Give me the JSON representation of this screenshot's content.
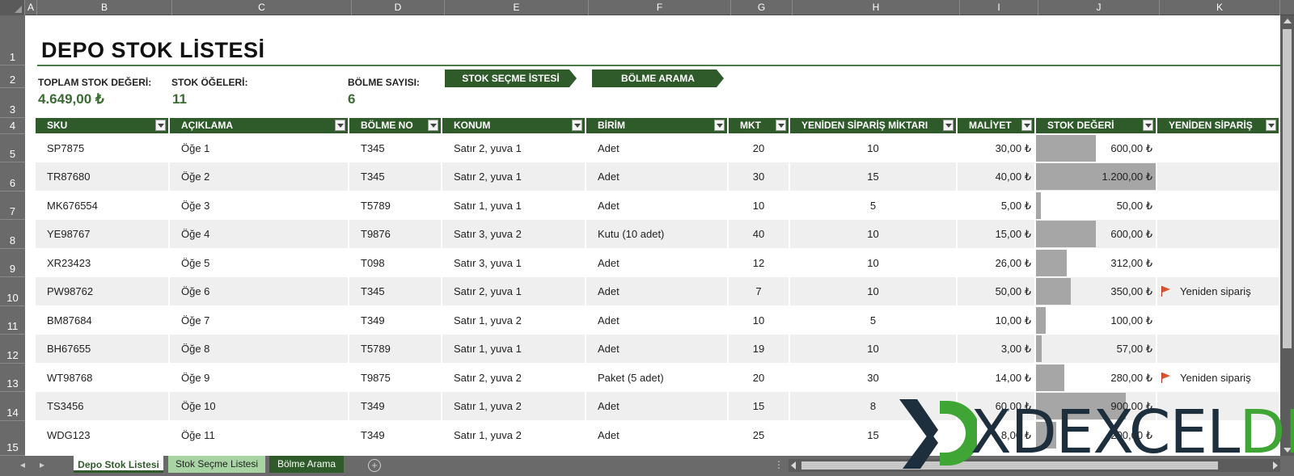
{
  "column_headers": [
    "A",
    "B",
    "C",
    "D",
    "E",
    "F",
    "G",
    "H",
    "I",
    "J",
    "K"
  ],
  "row_headers": [
    "1",
    "2",
    "3",
    "4",
    "5",
    "6",
    "7",
    "8",
    "9",
    "10",
    "11",
    "12",
    "13",
    "14",
    "15"
  ],
  "title": "DEPO STOK LİSTESİ",
  "kpis": [
    {
      "label": "TOPLAM STOK DEĞERİ:",
      "value": "4.649,00 ₺"
    },
    {
      "label": "STOK ÖĞELERİ:",
      "value": "11"
    },
    {
      "label": "BÖLME SAYISI:",
      "value": "6"
    }
  ],
  "nav_buttons": [
    "STOK SEÇME İSTESİ",
    "BÖLME ARAMA"
  ],
  "table": {
    "headers": [
      "SKU",
      "AÇIKLAMA",
      "BÖLME NO",
      "KONUM",
      "BİRİM",
      "MKT",
      "YENİDEN SİPARİŞ MİKTARI",
      "MALİYET",
      "STOK DEĞERİ",
      "YENİDEN SİPARİŞ"
    ],
    "stock_value_max": 1200,
    "rows": [
      {
        "sku": "SP7875",
        "desc": "Öğe 1",
        "bin": "T345",
        "loc": "Satır 2, yuva 1",
        "unit": "Adet",
        "qty": "20",
        "reorder_qty": "10",
        "cost": "30,00 ₺",
        "value": "600,00 ₺",
        "value_num": 600,
        "reorder": ""
      },
      {
        "sku": "TR87680",
        "desc": "Öğe 2",
        "bin": "T345",
        "loc": "Satır 2, yuva 1",
        "unit": "Adet",
        "qty": "30",
        "reorder_qty": "15",
        "cost": "40,00 ₺",
        "value": "1.200,00 ₺",
        "value_num": 1200,
        "reorder": ""
      },
      {
        "sku": "MK676554",
        "desc": "Öğe 3",
        "bin": "T5789",
        "loc": "Satır 1, yuva 1",
        "unit": "Adet",
        "qty": "10",
        "reorder_qty": "5",
        "cost": "5,00 ₺",
        "value": "50,00 ₺",
        "value_num": 50,
        "reorder": ""
      },
      {
        "sku": "YE98767",
        "desc": "Öğe 4",
        "bin": "T9876",
        "loc": "Satır 3, yuva 2",
        "unit": "Kutu (10 adet)",
        "qty": "40",
        "reorder_qty": "10",
        "cost": "15,00 ₺",
        "value": "600,00 ₺",
        "value_num": 600,
        "reorder": ""
      },
      {
        "sku": "XR23423",
        "desc": "Öğe 5",
        "bin": "T098",
        "loc": "Satır 3, yuva 1",
        "unit": "Adet",
        "qty": "12",
        "reorder_qty": "10",
        "cost": "26,00 ₺",
        "value": "312,00 ₺",
        "value_num": 312,
        "reorder": ""
      },
      {
        "sku": "PW98762",
        "desc": "Öğe 6",
        "bin": "T345",
        "loc": "Satır 2, yuva 1",
        "unit": "Adet",
        "qty": "7",
        "reorder_qty": "10",
        "cost": "50,00 ₺",
        "value": "350,00 ₺",
        "value_num": 350,
        "reorder": "Yeniden sipariş"
      },
      {
        "sku": "BM87684",
        "desc": "Öğe 7",
        "bin": "T349",
        "loc": "Satır 1, yuva 2",
        "unit": "Adet",
        "qty": "10",
        "reorder_qty": "5",
        "cost": "10,00 ₺",
        "value": "100,00 ₺",
        "value_num": 100,
        "reorder": ""
      },
      {
        "sku": "BH67655",
        "desc": "Öğe 8",
        "bin": "T5789",
        "loc": "Satır 1, yuva 1",
        "unit": "Adet",
        "qty": "19",
        "reorder_qty": "10",
        "cost": "3,00 ₺",
        "value": "57,00 ₺",
        "value_num": 57,
        "reorder": ""
      },
      {
        "sku": "WT98768",
        "desc": "Öğe 9",
        "bin": "T9875",
        "loc": "Satır 2, yuva 2",
        "unit": "Paket (5 adet)",
        "qty": "20",
        "reorder_qty": "30",
        "cost": "14,00 ₺",
        "value": "280,00 ₺",
        "value_num": 280,
        "reorder": "Yeniden sipariş"
      },
      {
        "sku": "TS3456",
        "desc": "Öğe 10",
        "bin": "T349",
        "loc": "Satır 1, yuva 2",
        "unit": "Adet",
        "qty": "15",
        "reorder_qty": "8",
        "cost": "60,00 ₺",
        "value": "900,00 ₺",
        "value_num": 900,
        "reorder": ""
      },
      {
        "sku": "WDG123",
        "desc": "Öğe 11",
        "bin": "T349",
        "loc": "Satır 1, yuva 2",
        "unit": "Adet",
        "qty": "25",
        "reorder_qty": "15",
        "cost": "8,00 ₺",
        "value": "200,00 ₺",
        "value_num": 200,
        "reorder": ""
      }
    ]
  },
  "sheet_tabs": [
    "Depo Stok Listesi",
    "Stok Seçme Listesi",
    "Bölme Arama"
  ],
  "add_sheet_icon": "+",
  "logo": {
    "part1": "XDEXCEL",
    "part2": "DEPO"
  },
  "colors": {
    "accent": "#2f5b2b",
    "kpi": "#3b6b33",
    "bar": "#a6a6a6",
    "flag": "#d9542c",
    "logo_green": "#3fa535",
    "logo_dark": "#1d2f3d"
  }
}
